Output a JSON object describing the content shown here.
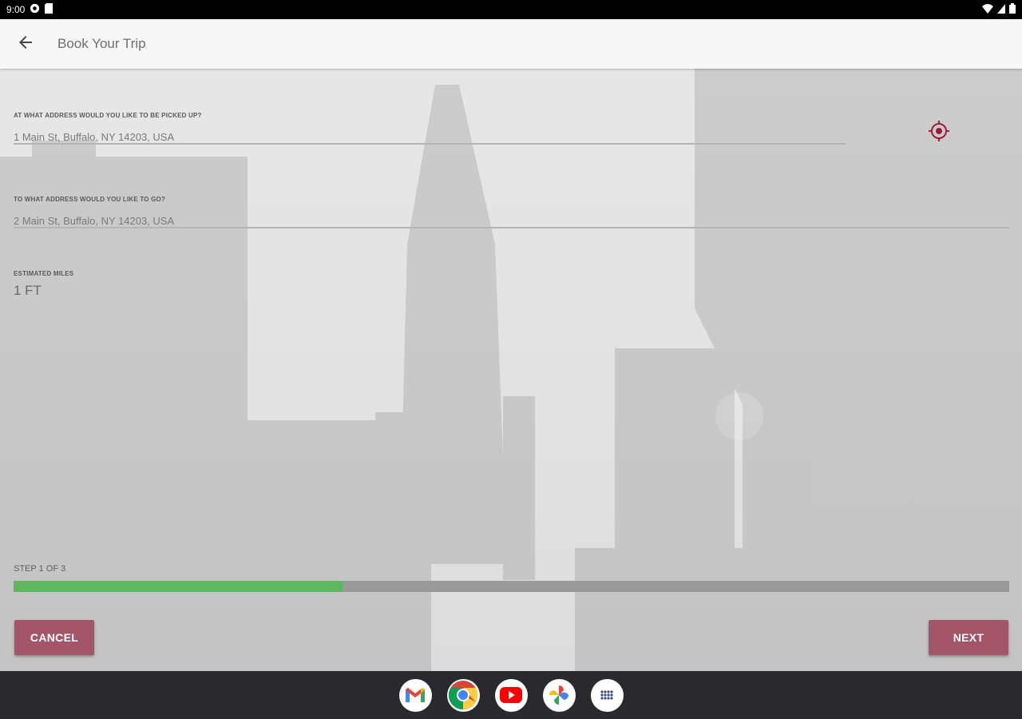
{
  "status_bar": {
    "time": "9:00"
  },
  "app_bar": {
    "title": "Book Your Trip"
  },
  "form": {
    "pickup": {
      "label": "AT WHAT ADDRESS WOULD YOU LIKE TO BE PICKED UP?",
      "value": "1 Main St, Buffalo, NY 14203, USA"
    },
    "dropoff": {
      "label": "TO WHAT ADDRESS WOULD YOU LIKE TO GO?",
      "value": "2 Main St, Buffalo, NY 14203, USA"
    },
    "miles": {
      "label": "ESTIMATED MILES",
      "value": "1 FT"
    }
  },
  "progress": {
    "label": "STEP 1 OF 3",
    "fraction": 0.33
  },
  "buttons": {
    "cancel": "CANCEL",
    "next": "NEXT"
  },
  "colors": {
    "accent": "#a3566a",
    "progress": "#5cb85c",
    "gps_icon": "#9b1c3f"
  },
  "dock": [
    "gmail-icon",
    "chrome-icon",
    "youtube-icon",
    "photos-icon",
    "app-launcher-icon"
  ]
}
